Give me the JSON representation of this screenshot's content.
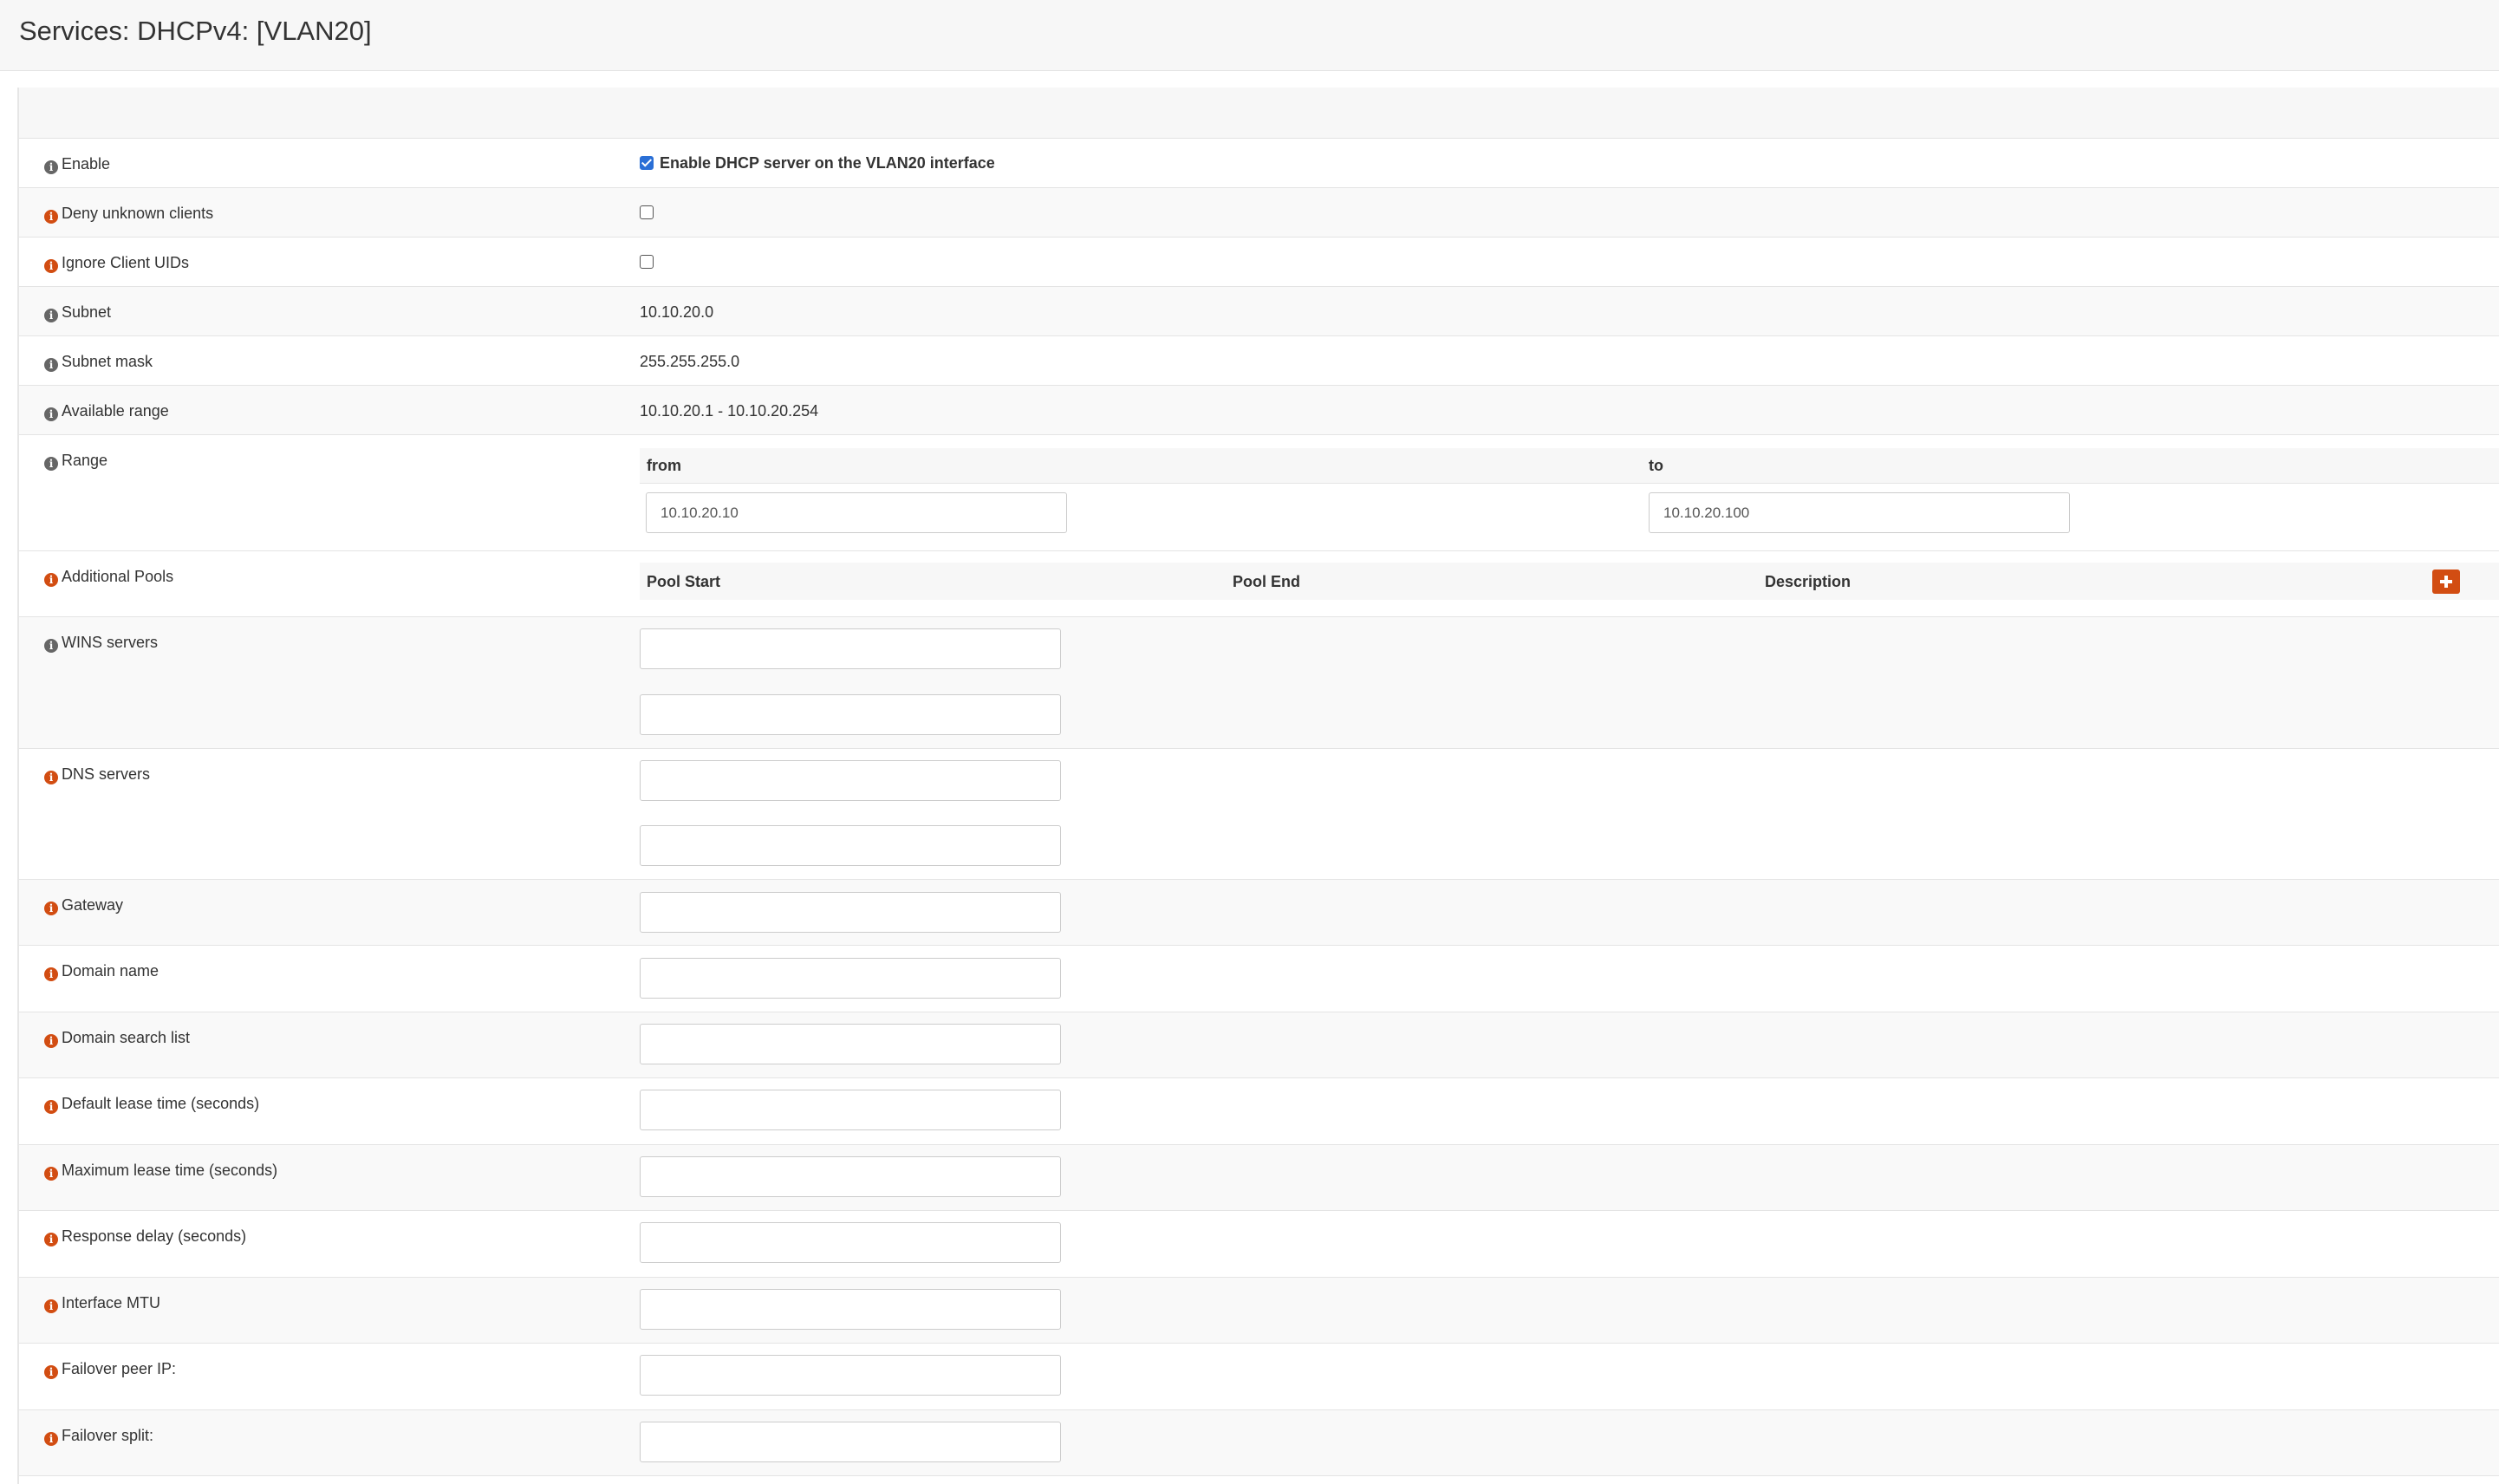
{
  "header": {
    "title": "Services: DHCPv4: [VLAN20]"
  },
  "rows": {
    "enable": {
      "label": "Enable",
      "checkbox_label": "Enable DHCP server on the VLAN20 interface",
      "checked": true
    },
    "deny_unknown": {
      "label": "Deny unknown clients",
      "checked": false
    },
    "ignore_uids": {
      "label": "Ignore Client UIDs",
      "checked": false
    },
    "subnet": {
      "label": "Subnet",
      "value": "10.10.20.0"
    },
    "subnet_mask": {
      "label": "Subnet mask",
      "value": "255.255.255.0"
    },
    "available_range": {
      "label": "Available range",
      "value": "10.10.20.1 - 10.10.20.254"
    },
    "range": {
      "label": "Range",
      "from_label": "from",
      "to_label": "to",
      "from_value": "10.10.20.10",
      "to_value": "10.10.20.100"
    },
    "additional_pools": {
      "label": "Additional Pools",
      "col_pool_start": "Pool Start",
      "col_pool_end": "Pool End",
      "col_description": "Description"
    },
    "wins": {
      "label": "WINS servers",
      "value_1": "",
      "value_2": ""
    },
    "dns": {
      "label": "DNS servers",
      "value_1": "",
      "value_2": ""
    },
    "gateway": {
      "label": "Gateway",
      "value": ""
    },
    "domain_name": {
      "label": "Domain name",
      "value": ""
    },
    "domain_search": {
      "label": "Domain search list",
      "value": ""
    },
    "default_lease": {
      "label": "Default lease time (seconds)",
      "value": ""
    },
    "max_lease": {
      "label": "Maximum lease time (seconds)",
      "value": ""
    },
    "response_delay": {
      "label": "Response delay (seconds)",
      "value": ""
    },
    "mtu": {
      "label": "Interface MTU",
      "value": ""
    },
    "failover_ip": {
      "label": "Failover peer IP:",
      "value": ""
    },
    "failover_split": {
      "label": "Failover split:",
      "value": ""
    }
  },
  "icons": {
    "info": "i",
    "info_color_gray": "#666666",
    "info_color_orange": "#d24d12",
    "add_color": "#d24d12"
  }
}
